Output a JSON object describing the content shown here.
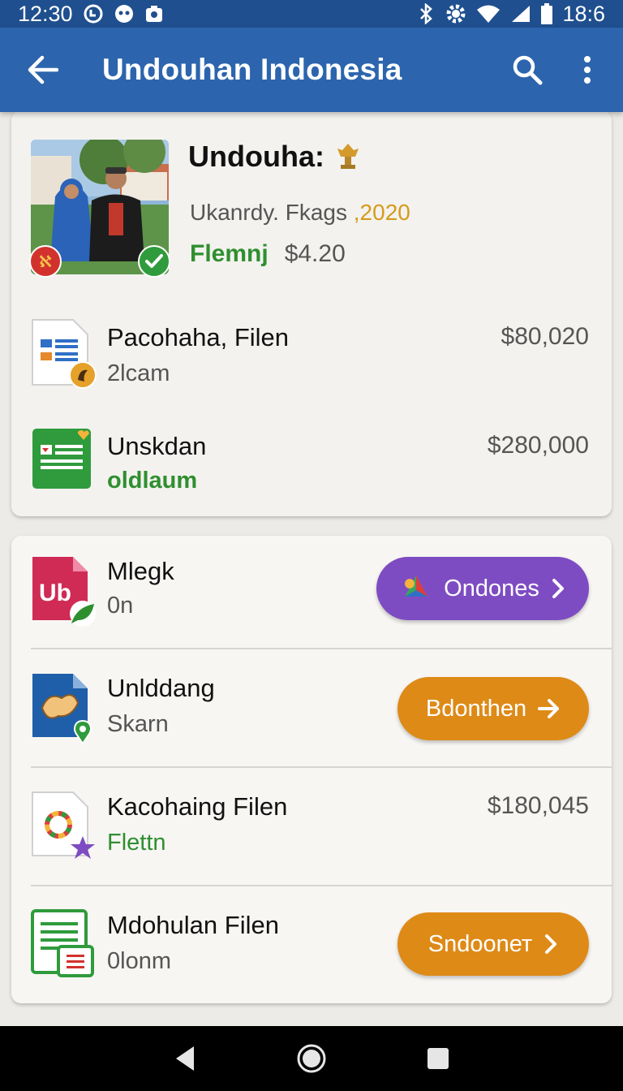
{
  "status_bar": {
    "time_left": "12:30",
    "time_right": "18:6",
    "icons_left": [
      "sync-icon",
      "notification-icon",
      "bag-icon"
    ],
    "icons_right": [
      "bluetooth-icon",
      "gear-icon",
      "wifi-icon",
      "signal-icon",
      "battery-icon"
    ]
  },
  "app_bar": {
    "title": "Undouhan Indonesia",
    "back_icon": "arrow-left-icon",
    "search_icon": "search-icon",
    "more_icon": "more-vert-icon"
  },
  "colors": {
    "primary": "#2c65ad",
    "primary_dark": "#1f4f8e",
    "green": "#2f8f2f",
    "gold": "#d69b1b",
    "purple": "#7e4cc2",
    "orange": "#de8a17"
  },
  "profile": {
    "name": "Undouha:",
    "meta_text": "Ukanrdy. Fkags ",
    "meta_year": ",2020",
    "status_label": "Flemnj",
    "status_price": "$4.20"
  },
  "card1_rows": [
    {
      "title": "Pacohaha, Filen",
      "subtitle": "2lcam",
      "amount": "$80,020",
      "icon": "document-icon"
    },
    {
      "title": "Unskdan",
      "subtitle": "oldlaum",
      "amount": "$280,000",
      "icon": "spreadsheet-icon"
    }
  ],
  "card2_rows": [
    {
      "title": "Mlegk",
      "subtitle": "0n",
      "icon": "app-ub-icon",
      "button": "Ondones"
    },
    {
      "title": "Unlddang",
      "subtitle": "Skarn",
      "icon": "map-file-icon",
      "button": "Bdonthen"
    },
    {
      "title": "Kacohaing Filen",
      "subtitle": "Flettn",
      "icon": "color-file-icon",
      "amount": "$180,045"
    },
    {
      "title": "Mdohulan Filen",
      "subtitle": "0lonm",
      "icon": "sheet-file-icon",
      "button": "Sndoonет"
    }
  ],
  "nav_bar": {
    "back": "nav-back-icon",
    "home": "nav-home-icon",
    "recents": "nav-recents-icon"
  }
}
